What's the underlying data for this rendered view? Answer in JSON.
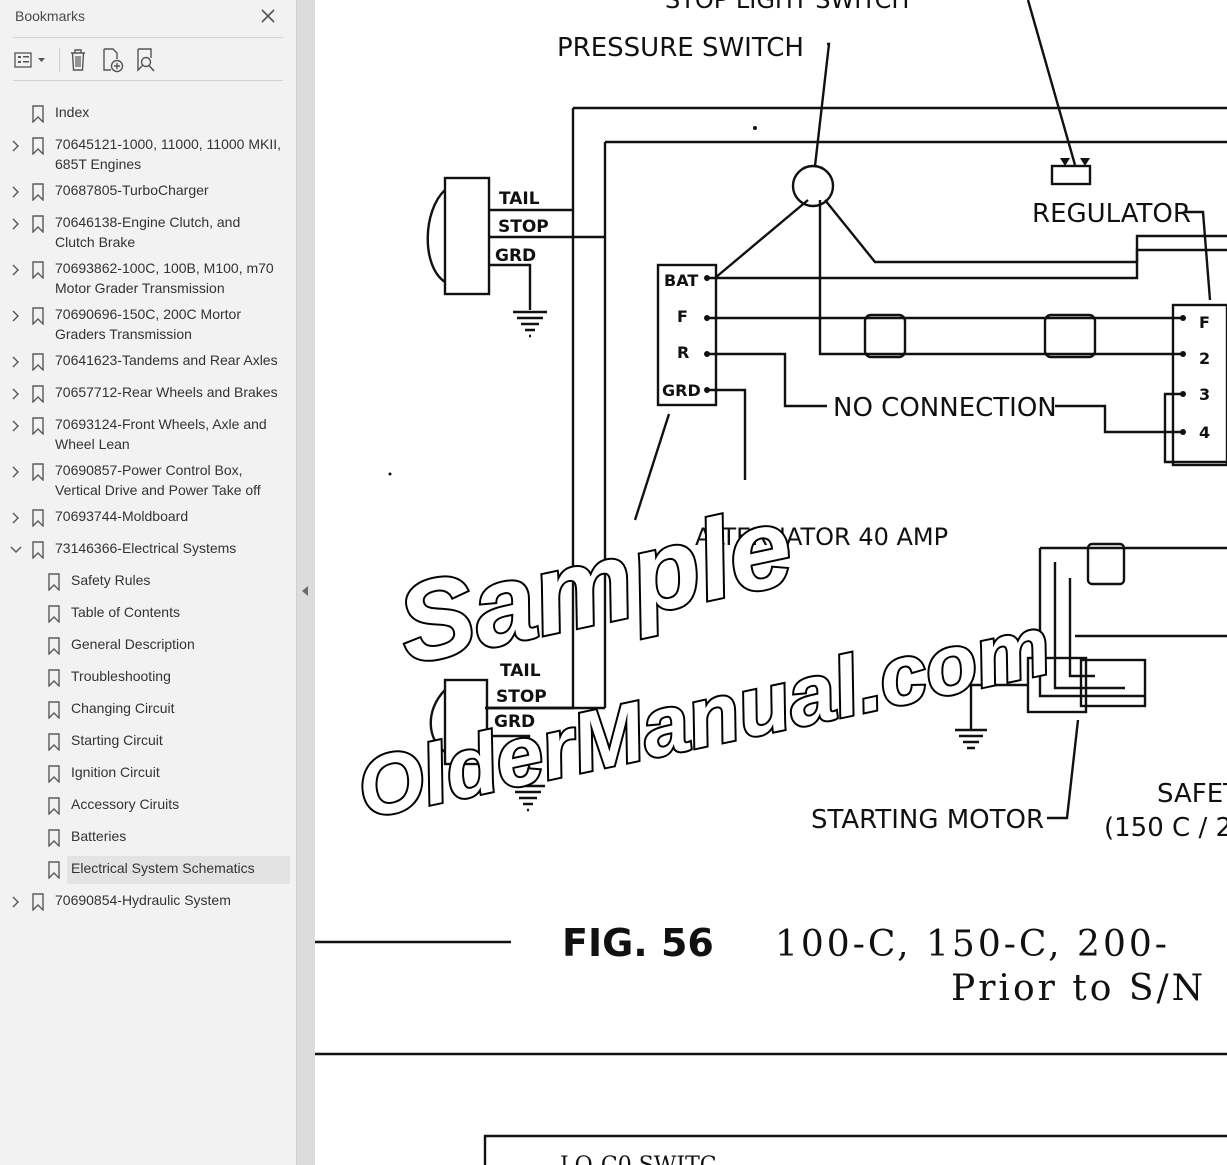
{
  "panel": {
    "title": "Bookmarks",
    "close_icon": "close-icon",
    "toolbar": [
      "options-menu-icon",
      "delete-bookmark-icon",
      "add-bookmark-icon",
      "find-bookmark-icon"
    ]
  },
  "bookmarks": [
    {
      "label": "Index",
      "lines": [
        "Index"
      ],
      "level": 0,
      "expand": "none"
    },
    {
      "label": "70645121-1000, 11000, 11000 MKII, 685T Engines",
      "lines": [
        "70645121-1000, 11000, 11000 MKII,",
        "685T Engines"
      ],
      "level": 0,
      "expand": "collapsed"
    },
    {
      "label": "70687805-TurboCharger",
      "lines": [
        "70687805-TurboCharger"
      ],
      "level": 0,
      "expand": "collapsed"
    },
    {
      "label": "70646138-Engine Clutch, and Clutch Brake",
      "lines": [
        "70646138-Engine Clutch, and",
        "Clutch Brake"
      ],
      "level": 0,
      "expand": "collapsed"
    },
    {
      "label": "70693862-100C, 100B, M100, m70 Motor Grader Transmission",
      "lines": [
        "70693862-100C, 100B, M100, m70",
        "Motor Grader Transmission"
      ],
      "level": 0,
      "expand": "collapsed"
    },
    {
      "label": "70690696-150C, 200C Mortor Graders Transmission",
      "lines": [
        "70690696-150C, 200C Mortor",
        "Graders Transmission"
      ],
      "level": 0,
      "expand": "collapsed"
    },
    {
      "label": "70641623-Tandems and Rear Axles",
      "lines": [
        "70641623-Tandems and Rear Axles"
      ],
      "level": 0,
      "expand": "collapsed"
    },
    {
      "label": "70657712-Rear Wheels and Brakes",
      "lines": [
        "70657712-Rear Wheels and Brakes"
      ],
      "level": 0,
      "expand": "collapsed"
    },
    {
      "label": "70693124-Front Wheels, Axle and Wheel Lean",
      "lines": [
        "70693124-Front Wheels, Axle and",
        "Wheel Lean"
      ],
      "level": 0,
      "expand": "collapsed"
    },
    {
      "label": "70690857-Power Control Box, Vertical Drive and Power Take off",
      "lines": [
        "70690857-Power Control Box,",
        "Vertical Drive and Power Take off"
      ],
      "level": 0,
      "expand": "collapsed"
    },
    {
      "label": "70693744-Moldboard",
      "lines": [
        "70693744-Moldboard"
      ],
      "level": 0,
      "expand": "collapsed"
    },
    {
      "label": "73146366-Electrical Systems",
      "lines": [
        "73146366-Electrical Systems"
      ],
      "level": 0,
      "expand": "expanded"
    },
    {
      "label": "Safety Rules",
      "lines": [
        "Safety Rules"
      ],
      "level": 1,
      "expand": "none"
    },
    {
      "label": "Table of Contents",
      "lines": [
        "Table of Contents"
      ],
      "level": 1,
      "expand": "none"
    },
    {
      "label": "General Description",
      "lines": [
        "General Description"
      ],
      "level": 1,
      "expand": "none"
    },
    {
      "label": "Troubleshooting",
      "lines": [
        "Troubleshooting"
      ],
      "level": 1,
      "expand": "none"
    },
    {
      "label": "Changing Circuit",
      "lines": [
        "Changing Circuit"
      ],
      "level": 1,
      "expand": "none"
    },
    {
      "label": "Starting Circuit",
      "lines": [
        "Starting Circuit"
      ],
      "level": 1,
      "expand": "none"
    },
    {
      "label": "Ignition Circuit",
      "lines": [
        "Ignition Circuit"
      ],
      "level": 1,
      "expand": "none"
    },
    {
      "label": "Accessory Ciruits",
      "lines": [
        "Accessory Ciruits"
      ],
      "level": 1,
      "expand": "none"
    },
    {
      "label": "Batteries",
      "lines": [
        "Batteries"
      ],
      "level": 1,
      "expand": "none"
    },
    {
      "label": "Electrical System Schematics",
      "lines": [
        "Electrical System Schematics"
      ],
      "level": 1,
      "expand": "none",
      "selected": true
    },
    {
      "label": "70690854-Hydraulic System",
      "lines": [
        "70690854-Hydraulic System"
      ],
      "level": 0,
      "expand": "collapsed"
    }
  ],
  "splitter": {
    "collapse_icon": "collapse-panel-icon"
  },
  "document": {
    "top_label": "STOP LIGHT SWITCH",
    "pressure_switch": "PRESSURE SWITCH",
    "regulator": "REGULATOR",
    "tail": "TAIL",
    "stop": "STOP",
    "grd": "GRD",
    "bat": "BAT",
    "f": "F",
    "r": "R",
    "no_connection": "NO CONNECTION",
    "alternator": "ALTERNATOR 40 AMP",
    "tail2": "TAIL",
    "stop2": "STOP",
    "grd2": "GRD",
    "starting_motor": "STARTING MOTOR",
    "safety": "SAFET",
    "safety_models": "(150 C / 2",
    "term_f": "F",
    "term_2": "2",
    "term_3": "3",
    "term_4": "4",
    "fig_label": "FIG. 56",
    "fig_models": "100-C, 150-C, 200-",
    "fig_prior": "Prior to S/N",
    "bottom_text": "LO-C0 SWITC",
    "watermark_1": "Sample",
    "watermark_2": "OlderManual.com"
  }
}
